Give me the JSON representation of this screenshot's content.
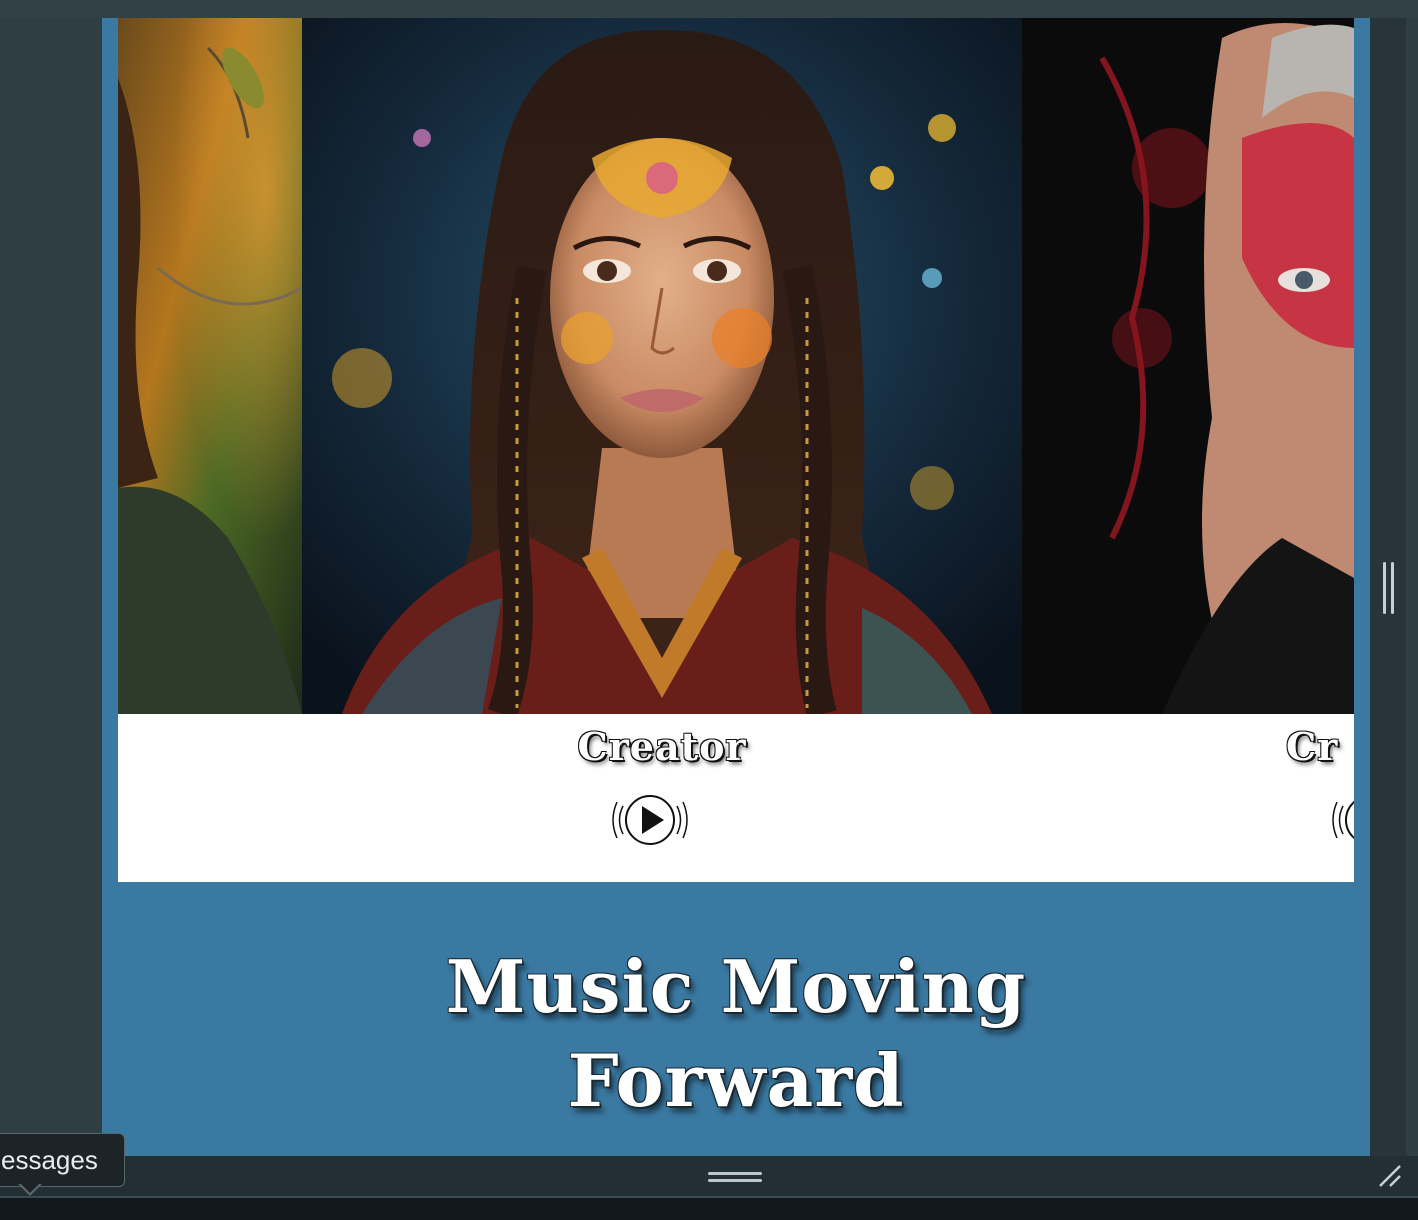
{
  "carousel": {
    "slides": [
      {
        "caption": "",
        "image": "woman-in-forest-portrait"
      },
      {
        "caption": "Creator",
        "image": "woman-with-golden-face-paint-portrait",
        "play_icon": "play-sound-icon"
      },
      {
        "caption": "Cr",
        "image": "man-with-red-paint-splash-portrait",
        "play_icon": "play-sound-icon"
      }
    ]
  },
  "hero": {
    "title_line1": "Music Moving",
    "title_line2": "Forward"
  },
  "tooltip": {
    "text": "essages"
  },
  "colors": {
    "panel_blue": "#3a79a2",
    "editor_bg": "#2f3e43",
    "tooltip_bg": "#1c2428"
  }
}
